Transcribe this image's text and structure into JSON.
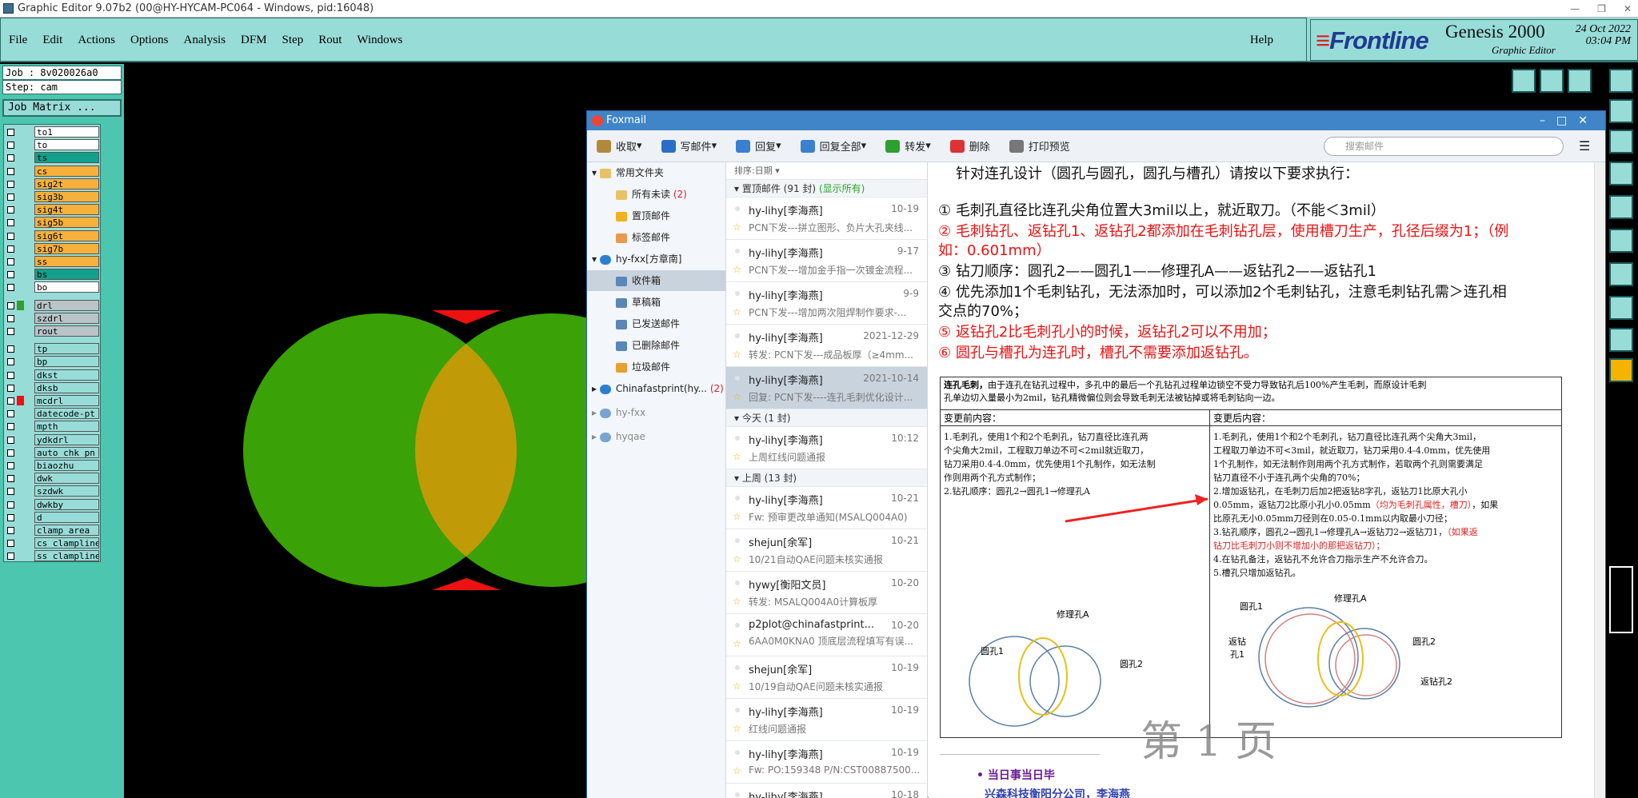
{
  "titlebar": {
    "text": "Graphic Editor 9.07b2 (00@HY-HYCAM-PC064 - Windows, pid:16048)"
  },
  "menu": {
    "items": [
      "File",
      "Edit",
      "Actions",
      "Options",
      "Analysis",
      "DFM",
      "Step",
      "Rout",
      "Windows"
    ],
    "help": "Help"
  },
  "brand": {
    "logo": "Frontline",
    "product": "Genesis 2000",
    "subtitle": "Graphic Editor",
    "date": "24 Oct 2022",
    "time": "03:04 PM"
  },
  "job": {
    "job_line": "Job : 8v020026a0",
    "step_line": "Step: cam",
    "matrix_label": "Job Matrix ..."
  },
  "layers": [
    {
      "name": "to1",
      "fill": "#ffffff",
      "color": ""
    },
    {
      "name": "to",
      "fill": "#ffffff",
      "color": ""
    },
    {
      "name": "ts",
      "fill": "#12a08a",
      "color": ""
    },
    {
      "name": "cs",
      "fill": "#f5b13c",
      "color": ""
    },
    {
      "name": "sig2t",
      "fill": "#f5b13c",
      "color": ""
    },
    {
      "name": "sig3b",
      "fill": "#f5b13c",
      "color": ""
    },
    {
      "name": "sig4t",
      "fill": "#f5b13c",
      "color": ""
    },
    {
      "name": "sig5b",
      "fill": "#f5b13c",
      "color": ""
    },
    {
      "name": "sig6t",
      "fill": "#f5b13c",
      "color": ""
    },
    {
      "name": "sig7b",
      "fill": "#f5b13c",
      "color": ""
    },
    {
      "name": "ss",
      "fill": "#f5b13c",
      "color": ""
    },
    {
      "name": "bs",
      "fill": "#12a08a",
      "color": ""
    },
    {
      "name": "bo",
      "fill": "#ffffff",
      "color": ""
    },
    {
      "name": "drl",
      "fill": "#b8c4c8",
      "color": "#2ea02e"
    },
    {
      "name": "szdrl",
      "fill": "#b8c4c8",
      "color": ""
    },
    {
      "name": "rout",
      "fill": "#b8c4c8",
      "color": ""
    },
    {
      "name": "tp",
      "fill": "#98dcd8",
      "color": ""
    },
    {
      "name": "bp",
      "fill": "#98dcd8",
      "color": ""
    },
    {
      "name": "dkst",
      "fill": "#98dcd8",
      "color": ""
    },
    {
      "name": "dksb",
      "fill": "#98dcd8",
      "color": ""
    },
    {
      "name": "mcdrl",
      "fill": "#98dcd8",
      "color": "#e11"
    },
    {
      "name": "datecode-pt",
      "fill": "#98dcd8",
      "color": ""
    },
    {
      "name": "mpth",
      "fill": "#98dcd8",
      "color": ""
    },
    {
      "name": "ydkdrl",
      "fill": "#98dcd8",
      "color": ""
    },
    {
      "name": "auto_chk_pn",
      "fill": "#98dcd8",
      "color": ""
    },
    {
      "name": "biaozhu",
      "fill": "#98dcd8",
      "color": ""
    },
    {
      "name": "dwk",
      "fill": "#98dcd8",
      "color": ""
    },
    {
      "name": "szdwk",
      "fill": "#98dcd8",
      "color": ""
    },
    {
      "name": "dwkby",
      "fill": "#98dcd8",
      "color": ""
    },
    {
      "name": "d",
      "fill": "#98dcd8",
      "color": ""
    },
    {
      "name": "clamp_area",
      "fill": "#98dcd8",
      "color": ""
    },
    {
      "name": "cs_clampline",
      "fill": "#98dcd8",
      "color": ""
    },
    {
      "name": "ss_clampline",
      "fill": "#98dcd8",
      "color": ""
    }
  ],
  "foxmail": {
    "title": "Foxmail",
    "toolbar": [
      "收取",
      "写邮件",
      "回复",
      "回复全部",
      "转发",
      "删除",
      "打印预览"
    ],
    "search_placeholder": "搜索邮件",
    "nav": {
      "common": "常用文件夹",
      "unread": "所有未读",
      "unread_count": "(2)",
      "pinned": "置顶邮件",
      "tagged": "标签邮件",
      "account1": "hy-fxx[方章南]",
      "inbox": "收件箱",
      "drafts": "草稿箱",
      "sent": "已发送邮件",
      "deleted": "已删除邮件",
      "junk": "垃圾邮件",
      "account2": "Chinafastprint(hy...",
      "account2_count": "(2)",
      "account3": "hy-fxx",
      "account4": "hyqae"
    },
    "sort_label": "排序:日期",
    "groups": {
      "pinned": "置顶邮件 (91 封)",
      "pinned_show": "(显示所有)",
      "today": "今天 (1 封)",
      "lastweek": "上周 (13 封)"
    },
    "mails_pinned": [
      {
        "from": "hy-lihy[李海燕]",
        "date": "10-19",
        "subject": "PCN下发---拼立图形、负片大孔夹线..."
      },
      {
        "from": "hy-lihy[李海燕]",
        "date": "9-17",
        "subject": "PCN下发---增加金手指一次镀金流程..."
      },
      {
        "from": "hy-lihy[李海燕]",
        "date": "9-9",
        "subject": "PCN下发---增加两次阻焊制作要求-..."
      },
      {
        "from": "hy-lihy[李海燕]",
        "date": "2021-12-29",
        "subject": "转发: PCN下发---成品板厚（≥4mm..."
      },
      {
        "from": "hy-lihy[李海燕]",
        "date": "2021-10-14",
        "subject": "回复: PCN下发----连孔毛刺优化设计..."
      }
    ],
    "mails_today": [
      {
        "from": "hy-lihy[李海燕]",
        "date": "10:12",
        "subject": "上周红线问题通报"
      }
    ],
    "mails_week": [
      {
        "from": "hy-lihy[李海燕]",
        "date": "10-21",
        "subject": "Fw: 预审更改单通知(MSALQ004A0)"
      },
      {
        "from": "shejun[余军]",
        "date": "10-21",
        "subject": "10/21自动QAE问题未核实通报"
      },
      {
        "from": "hywy[衡阳文员]",
        "date": "10-20",
        "subject": "转发: MSALQ004A0计算板厚"
      },
      {
        "from": "p2plot@chinafastprint...",
        "date": "10-20",
        "subject": "6AA0M0KNA0 顶底层流程填写有误..."
      },
      {
        "from": "shejun[余军]",
        "date": "10-19",
        "subject": "10/19自动QAE问题未核实通报"
      },
      {
        "from": "hy-lihy[李海燕]",
        "date": "10-19",
        "subject": "红线问题通报"
      },
      {
        "from": "hy-lihy[李海燕]",
        "date": "10-19",
        "subject": "Fw:  PO:159348 P/N:CST00887500..."
      },
      {
        "from": "hy-lihy[李海燕]",
        "date": "10-18",
        "subject": ""
      }
    ],
    "content": {
      "heading": "针对连孔设计（圆孔与圆孔，圆孔与槽孔）请按以下要求执行：",
      "p1": "①   毛刺孔直径比连孔尖角位置大3mil以上，就近取刀。（不能＜3mil）",
      "p2a": "②   毛刺钻孔、返钻孔1、返钻孔2都添加在毛刺钻孔层，使用槽刀生产，孔径后缀为1；（例",
      "p2b": "如：0.601mm）",
      "p3": "③   钻刀顺序：圆孔2——圆孔1——修理孔A——返钻孔2——返钻孔1",
      "p4a": "④      优先添加1个毛刺钻孔，无法添加时，可以添加2个毛刺钻孔，注意毛刺钻孔需＞连孔相",
      "p4b": "交点的70%；",
      "p5": "⑤   返钻孔2比毛刺孔小的时候，返钻孔2可以不用加；",
      "p6": "⑥   圆孔与槽孔为连孔时，槽孔不需要添加返钻孔。",
      "table_title": "连孔毛刺，",
      "table_intro1": "由于连孔在钻孔过程中，多孔中的最后一个孔钻孔过程单边锁空不受力导致钻孔后100%产生毛刺，而原设计毛刺",
      "table_intro2": "孔单边切入量最小为2mil，钻孔精微偏位则会导致毛刺无法被钻掉或将毛刺钻向一边。",
      "before_header": "变更前内容：",
      "after_header": "变更后内容：",
      "before_lines": [
        "1.毛刺孔，使用1个和2个毛刺孔，钻刀直径比连孔两",
        "个尖角大2mil，工程取刀单边不可<2mil就近取刀，",
        "钻刀采用0.4-4.0mm，优先使用1个孔制作，如无法制",
        "作则用两个孔方式制作；",
        "2.钻孔顺序：圆孔2→圆孔1→修理孔A"
      ],
      "after_lines": [
        "1.毛刺孔，使用1个和2个毛刺孔，钻刀直径比连孔两个尖角大3mil，",
        "工程取刀单边不可<3mil，就近取刀，钻刀采用0.4-4.0mm，优先使用",
        "1个孔制作，如无法制作则用两个孔方式制作，若取两个孔则需要满足",
        "钻刀直径不小于连孔两个尖角的70%；",
        "2.增加返钻孔，在毛刺刀后加2把返钻8字孔，返钻刀1比原大孔小",
        "0.05mm，返钻刀2比原小孔小0.05mm",
        "比原孔无小0.05mm刀径则在0.05-0.1mm以内取最小刀径；",
        "3.钻孔顺序，圆孔2→圆孔1→修理孔A→返钻刀2→返钻刀1，",
        "钻刀比毛刺刀小则不增加小的那把返钻刀）；",
        "4.在钻孔备注，返钻孔不允许合刀指示生产不允许合刀。",
        "5.槽孔只增加返钻孔。"
      ],
      "after_red1": "（均为毛刺孔属性，槽刀）",
      "after_tail1": "，如果",
      "after_red2": "（如果返",
      "diagram_left": {
        "label_a": "修理孔A",
        "label_1": "圆孔1",
        "label_2": "圆孔2"
      },
      "diagram_right": {
        "label_1": "圆孔1",
        "label_a": "修理孔A",
        "label_f1": "返钻",
        "label_f1b": "孔1",
        "label_2": "圆孔2",
        "label_f2": "返钻孔2"
      },
      "page_mark": "第 1 页",
      "bullet1": "当日事当日毕",
      "bullet2": "兴森科技衡阳分公司，李海燕"
    }
  }
}
